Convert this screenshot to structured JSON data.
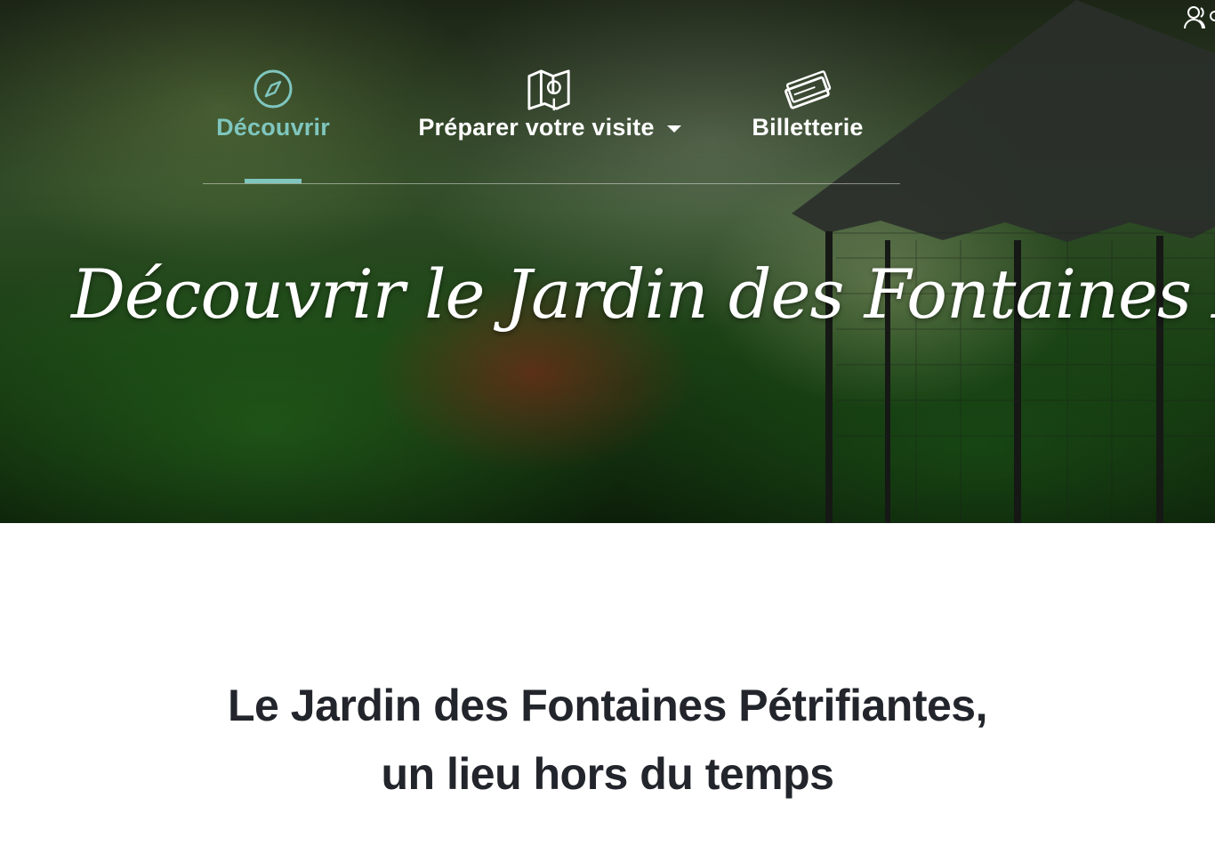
{
  "hero": {
    "title": "Découvrir le Jardin des Fontaines Pétrifiantes"
  },
  "nav": {
    "items": [
      {
        "label": "Découvrir",
        "icon": "compass-icon",
        "active": true
      },
      {
        "label": "Préparer votre visite",
        "icon": "map-pin-icon",
        "has_dropdown": true
      },
      {
        "label": "Billetterie",
        "icon": "ticket-icon"
      }
    ]
  },
  "header": {
    "user_icon": "users-icon"
  },
  "intro": {
    "line1": "Le Jardin des Fontaines Pétrifiantes,",
    "line2": "un lieu hors du temps"
  },
  "colors": {
    "accent": "#7fc6bf",
    "text_dark": "#22252b",
    "nav_text": "#ffffff"
  }
}
